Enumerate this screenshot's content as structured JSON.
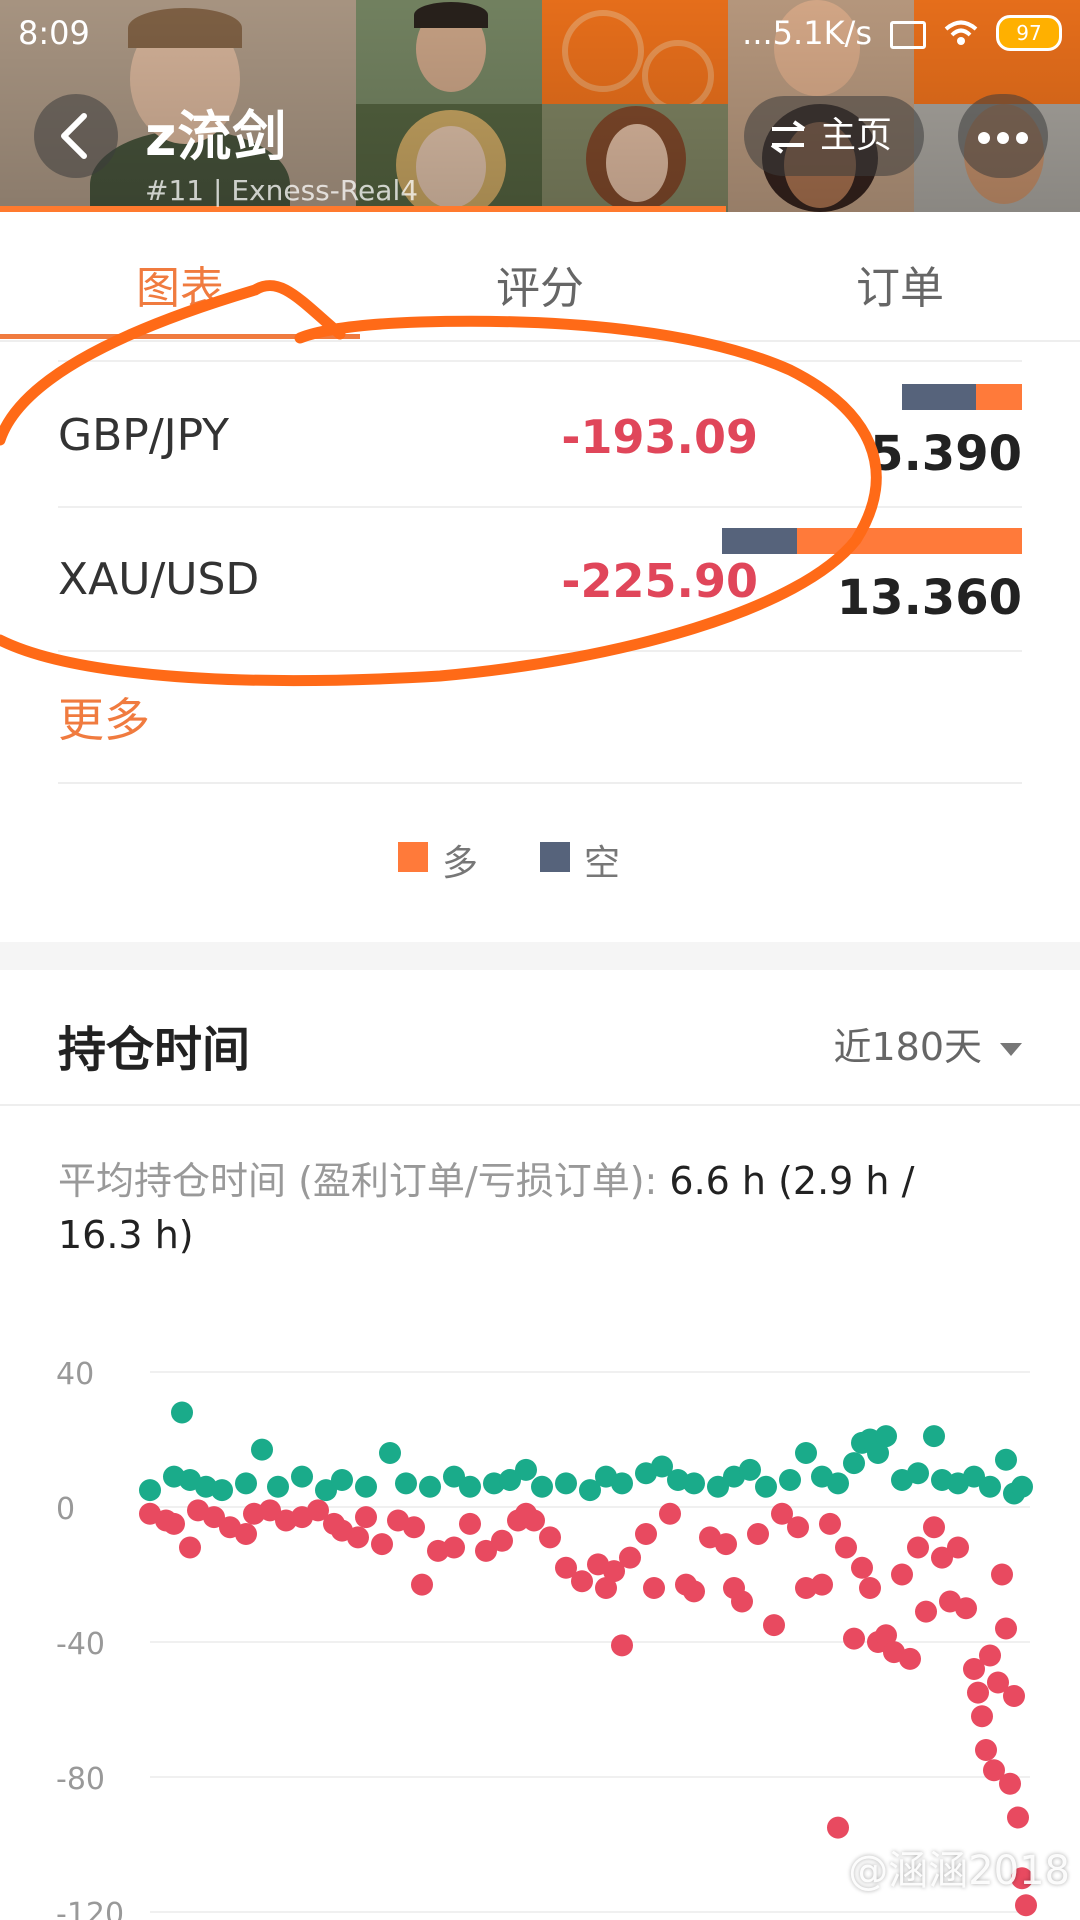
{
  "status_bar": {
    "time": "8:09",
    "network_speed": "...5.1K/s",
    "battery": "97"
  },
  "header": {
    "title": "z流剑",
    "rank": "#11",
    "server": "Exness-Real4",
    "home_label": "主页",
    "accent_color": "#ff7a2e"
  },
  "tabs": [
    {
      "label": "图表",
      "active": true
    },
    {
      "label": "评分",
      "active": false
    },
    {
      "label": "订单",
      "active": false
    }
  ],
  "symbols": [
    {
      "name": "GBP/JPY",
      "profit": "-193.09",
      "lots": "5.390",
      "short_share": 0.62,
      "long_share": 0.38,
      "bar_scale": 0.4
    },
    {
      "name": "XAU/USD",
      "profit": "-225.90",
      "lots": "13.360",
      "short_share": 0.25,
      "long_share": 0.75,
      "bar_scale": 1.0
    }
  ],
  "more_label": "更多",
  "legend": {
    "long": "多",
    "short": "空",
    "long_color": "#ff7a3a",
    "short_color": "#56637b"
  },
  "holding": {
    "title": "持仓时间",
    "period": "近180天",
    "avg_label": "平均持仓时间 (盈利订单/亏损订单): ",
    "avg_value": "6.6 h (2.9 h / 16.3 h)"
  },
  "chart_data": {
    "type": "scatter",
    "ylim": [
      -120,
      40
    ],
    "yticks": [
      "40",
      "0",
      "-40",
      "-80",
      "-120"
    ],
    "ytick_values": [
      40,
      0,
      -40,
      -80,
      -120
    ],
    "grid": true,
    "series": [
      {
        "color": "#1aab8a",
        "points": [
          [
            0,
            5
          ],
          [
            3,
            9
          ],
          [
            4,
            28
          ],
          [
            5,
            8
          ],
          [
            7,
            6
          ],
          [
            9,
            5
          ],
          [
            12,
            7
          ],
          [
            14,
            17
          ],
          [
            16,
            6
          ],
          [
            19,
            9
          ],
          [
            22,
            5
          ],
          [
            24,
            8
          ],
          [
            27,
            6
          ],
          [
            30,
            16
          ],
          [
            32,
            7
          ],
          [
            35,
            6
          ],
          [
            38,
            9
          ],
          [
            40,
            6
          ],
          [
            43,
            7
          ],
          [
            45,
            8
          ],
          [
            47,
            11
          ],
          [
            49,
            6
          ],
          [
            52,
            7
          ],
          [
            55,
            5
          ],
          [
            57,
            9
          ],
          [
            59,
            7
          ],
          [
            62,
            10
          ],
          [
            64,
            12
          ],
          [
            66,
            8
          ],
          [
            68,
            7
          ],
          [
            71,
            6
          ],
          [
            73,
            9
          ],
          [
            75,
            11
          ],
          [
            77,
            6
          ],
          [
            80,
            8
          ],
          [
            82,
            16
          ],
          [
            84,
            9
          ],
          [
            86,
            7
          ],
          [
            88,
            13
          ],
          [
            89,
            19
          ],
          [
            90,
            20
          ],
          [
            91,
            16
          ],
          [
            92,
            21
          ],
          [
            94,
            8
          ],
          [
            96,
            10
          ],
          [
            98,
            21
          ],
          [
            99,
            8
          ],
          [
            101,
            7
          ],
          [
            103,
            9
          ],
          [
            105,
            6
          ],
          [
            107,
            14
          ],
          [
            108,
            4
          ],
          [
            109,
            6
          ]
        ]
      },
      {
        "color": "#e84a60",
        "points": [
          [
            0,
            -2
          ],
          [
            2,
            -4
          ],
          [
            3,
            -5
          ],
          [
            5,
            -12
          ],
          [
            6,
            -1
          ],
          [
            8,
            -3
          ],
          [
            10,
            -6
          ],
          [
            12,
            -8
          ],
          [
            13,
            -2
          ],
          [
            15,
            -1
          ],
          [
            17,
            -4
          ],
          [
            19,
            -3
          ],
          [
            21,
            -1
          ],
          [
            23,
            -5
          ],
          [
            24,
            -7
          ],
          [
            26,
            -9
          ],
          [
            27,
            -3
          ],
          [
            29,
            -11
          ],
          [
            31,
            -4
          ],
          [
            33,
            -6
          ],
          [
            34,
            -23
          ],
          [
            36,
            -13
          ],
          [
            38,
            -12
          ],
          [
            40,
            -5
          ],
          [
            42,
            -13
          ],
          [
            44,
            -10
          ],
          [
            46,
            -4
          ],
          [
            47,
            -2
          ],
          [
            48,
            -4
          ],
          [
            50,
            -9
          ],
          [
            52,
            -18
          ],
          [
            54,
            -22
          ],
          [
            56,
            -17
          ],
          [
            57,
            -24
          ],
          [
            58,
            -19
          ],
          [
            59,
            -41
          ],
          [
            60,
            -15
          ],
          [
            62,
            -8
          ],
          [
            63,
            -24
          ],
          [
            65,
            -2
          ],
          [
            67,
            -23
          ],
          [
            68,
            -25
          ],
          [
            70,
            -9
          ],
          [
            72,
            -11
          ],
          [
            73,
            -24
          ],
          [
            74,
            -28
          ],
          [
            76,
            -8
          ],
          [
            78,
            -35
          ],
          [
            79,
            -2
          ],
          [
            81,
            -6
          ],
          [
            82,
            -24
          ],
          [
            84,
            -23
          ],
          [
            85,
            -5
          ],
          [
            86,
            -95
          ],
          [
            87,
            -12
          ],
          [
            88,
            -39
          ],
          [
            89,
            -18
          ],
          [
            90,
            -24
          ],
          [
            91,
            -40
          ],
          [
            92,
            -38
          ],
          [
            93,
            -43
          ],
          [
            94,
            -20
          ],
          [
            95,
            -45
          ],
          [
            96,
            -12
          ],
          [
            97,
            -31
          ],
          [
            98,
            -6
          ],
          [
            99,
            -15
          ],
          [
            100,
            -28
          ],
          [
            101,
            -12
          ],
          [
            102,
            -30
          ],
          [
            103,
            -48
          ],
          [
            103.5,
            -55
          ],
          [
            104,
            -62
          ],
          [
            104.5,
            -72
          ],
          [
            105,
            -44
          ],
          [
            105.5,
            -78
          ],
          [
            106,
            -52
          ],
          [
            106.5,
            -20
          ],
          [
            107,
            -36
          ],
          [
            107.5,
            -82
          ],
          [
            108,
            -56
          ],
          [
            108.5,
            -92
          ],
          [
            109,
            -110
          ],
          [
            109.5,
            -118
          ]
        ]
      }
    ]
  },
  "watermark": "@涵涵2018"
}
